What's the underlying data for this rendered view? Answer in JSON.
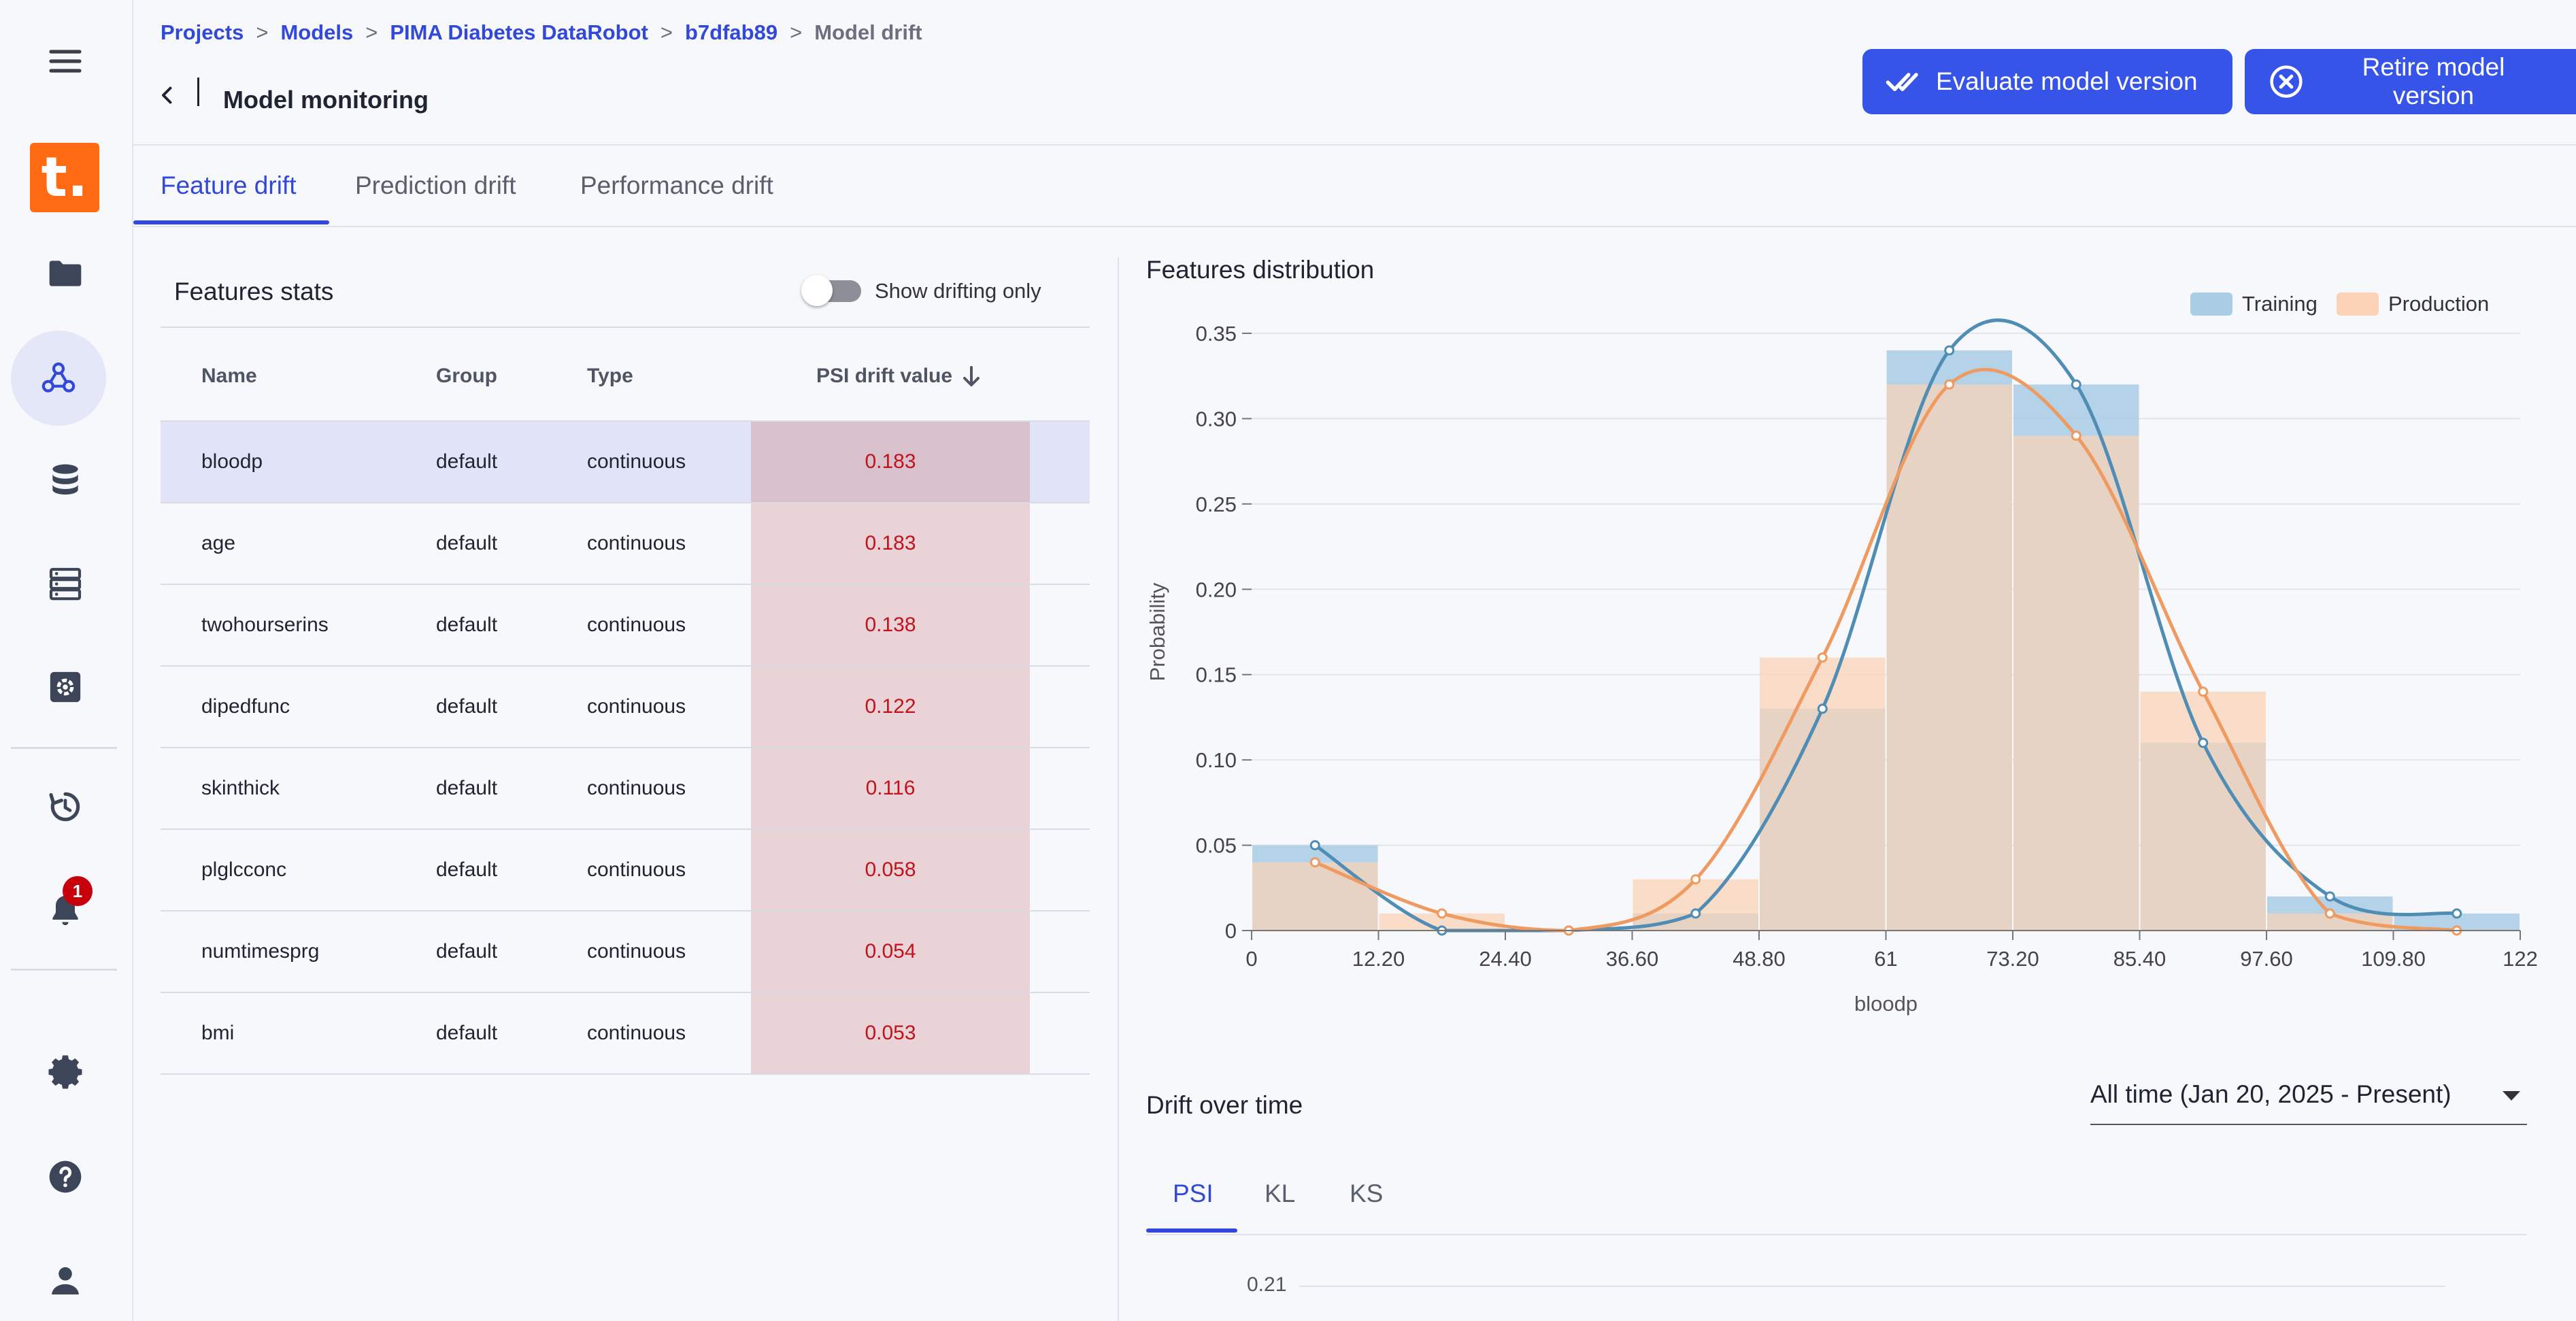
{
  "sidebar": {
    "logo_letter": "t.",
    "notification_count": "1"
  },
  "breadcrumb": [
    "Projects",
    "Models",
    "PIMA Diabetes DataRobot",
    "b7dfab89",
    "Model drift"
  ],
  "breadcrumb_separator": ">",
  "page_title": "Model monitoring",
  "actions": {
    "evaluate": "Evaluate model version",
    "retire": "Retire model version"
  },
  "tabs": [
    "Feature drift",
    "Prediction drift",
    "Performance drift"
  ],
  "features_stats": {
    "title": "Features stats",
    "toggle_label": "Show drifting only",
    "columns": [
      "Name",
      "Group",
      "Type",
      "PSI drift value"
    ],
    "rows": [
      {
        "name": "bloodp",
        "group": "default",
        "type": "continuous",
        "psi": "0.183"
      },
      {
        "name": "age",
        "group": "default",
        "type": "continuous",
        "psi": "0.183"
      },
      {
        "name": "twohourserins",
        "group": "default",
        "type": "continuous",
        "psi": "0.138"
      },
      {
        "name": "dipedfunc",
        "group": "default",
        "type": "continuous",
        "psi": "0.122"
      },
      {
        "name": "skinthick",
        "group": "default",
        "type": "continuous",
        "psi": "0.116"
      },
      {
        "name": "plglcconc",
        "group": "default",
        "type": "continuous",
        "psi": "0.058"
      },
      {
        "name": "numtimesprg",
        "group": "default",
        "type": "continuous",
        "psi": "0.054"
      },
      {
        "name": "bmi",
        "group": "default",
        "type": "continuous",
        "psi": "0.053"
      }
    ]
  },
  "features_distribution": {
    "title": "Features distribution"
  },
  "chart_data": {
    "type": "bar",
    "title": "",
    "xlabel": "bloodp",
    "ylabel": "Probability",
    "x_ticks": [
      "0",
      "12.20",
      "24.40",
      "36.60",
      "48.80",
      "61",
      "73.20",
      "85.40",
      "97.60",
      "109.80",
      "122"
    ],
    "y_ticks": [
      "0",
      "0.05",
      "0.10",
      "0.15",
      "0.20",
      "0.25",
      "0.30",
      "0.35"
    ],
    "xlim": [
      0,
      122
    ],
    "ylim": [
      0,
      0.35
    ],
    "bin_edges": [
      0,
      12.2,
      24.4,
      36.6,
      48.8,
      61,
      73.2,
      85.4,
      97.6,
      109.8,
      122
    ],
    "legend_position": "top-right",
    "series": [
      {
        "name": "Training",
        "color": "#a9cde4",
        "line_color": "#4f8db5",
        "values": [
          0.05,
          0.0,
          0.0,
          0.01,
          0.13,
          0.34,
          0.32,
          0.11,
          0.02,
          0.01
        ],
        "curve_points": [
          [
            6.1,
            0.05
          ],
          [
            18.3,
            0.0
          ],
          [
            30.5,
            0.0
          ],
          [
            42.7,
            0.01
          ],
          [
            54.9,
            0.13
          ],
          [
            67.1,
            0.34
          ],
          [
            79.3,
            0.32
          ],
          [
            91.5,
            0.11
          ],
          [
            103.7,
            0.02
          ],
          [
            115.9,
            0.01
          ]
        ]
      },
      {
        "name": "Production",
        "color": "#fbd2b6",
        "line_color": "#ee9a61",
        "values": [
          0.04,
          0.01,
          0.0,
          0.03,
          0.16,
          0.32,
          0.29,
          0.14,
          0.01,
          0.0
        ],
        "curve_points": [
          [
            6.1,
            0.04
          ],
          [
            18.3,
            0.01
          ],
          [
            30.5,
            0.0
          ],
          [
            42.7,
            0.03
          ],
          [
            54.9,
            0.16
          ],
          [
            67.1,
            0.32
          ],
          [
            79.3,
            0.29
          ],
          [
            91.5,
            0.14
          ],
          [
            103.7,
            0.01
          ],
          [
            115.9,
            0.0
          ]
        ]
      }
    ]
  },
  "drift_over_time": {
    "title": "Drift over time",
    "range": "All time (Jan 20, 2025 - Present)",
    "metric_tabs": [
      "PSI",
      "KL",
      "KS"
    ],
    "first_tick": "0.21"
  }
}
